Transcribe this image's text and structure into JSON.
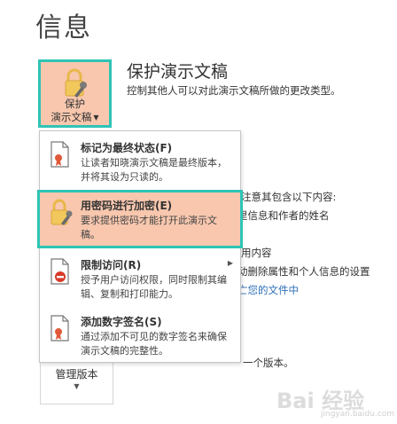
{
  "page_title": "信息",
  "protect_button": {
    "line1": "保护",
    "line2": "演示文稿"
  },
  "section": {
    "title": "保护演示文稿",
    "description": "控制其他人可以对此演示文稿所做的更改类型。"
  },
  "background": {
    "line1": "注意其包含以下内容:",
    "line2": "里信息和作者的姓名",
    "line3": "用内容",
    "line4": "动删除属性和个人信息的设置",
    "link": "亡您的文件中",
    "line5": "一个版本。"
  },
  "manage_versions": {
    "label": "管理版本"
  },
  "menu": {
    "items": [
      {
        "title": "标记为最终状态(F)",
        "desc": "让读者知晓演示文稿是最终版本，并将其设为只读的。"
      },
      {
        "title": "用密码进行加密(E)",
        "desc": "要求提供密码才能打开此演示文稿。"
      },
      {
        "title": "限制访问(R)",
        "desc": "授予用户访问权限，同时限制其编辑、复制和打印能力。"
      },
      {
        "title": "添加数字签名(S)",
        "desc": "通过添加不可见的数字签名来确保演示文稿的完整性。"
      }
    ]
  },
  "watermark": {
    "main": "Bai 经验",
    "sub": "jingyan.baidu.com"
  },
  "colors": {
    "highlight": "#f8c7ae",
    "outline": "#2ec4b6",
    "link": "#2e6fb6"
  }
}
